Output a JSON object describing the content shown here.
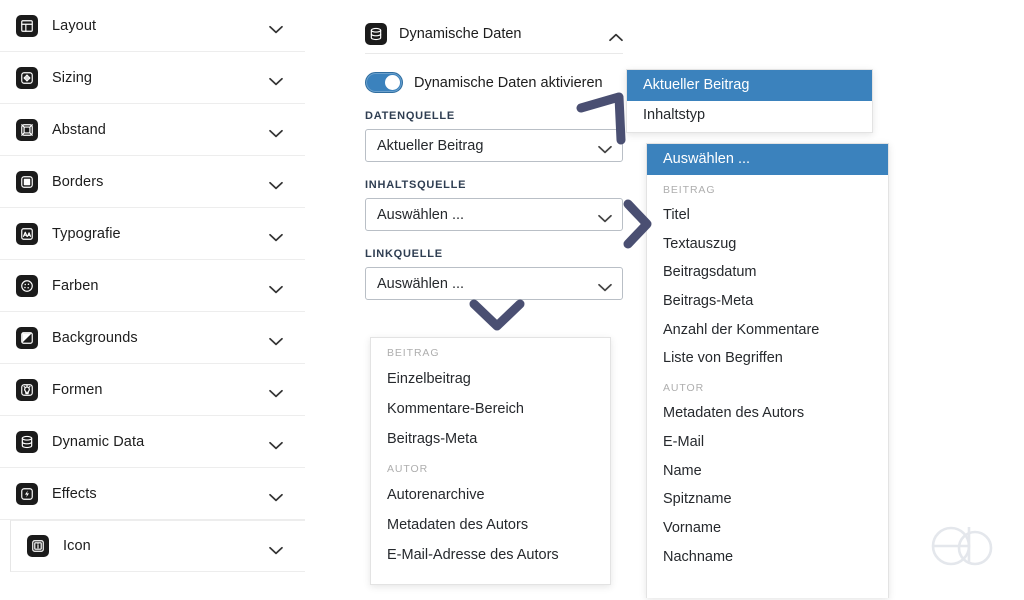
{
  "sidebar": {
    "items": [
      {
        "label": "Layout",
        "icon": "layout-icon",
        "chevron": "chevron-down-icon"
      },
      {
        "label": "Sizing",
        "icon": "sizing-icon",
        "chevron": "chevron-down-icon"
      },
      {
        "label": "Abstand",
        "icon": "spacing-icon",
        "chevron": "chevron-down-icon"
      },
      {
        "label": "Borders",
        "icon": "borders-icon",
        "chevron": "chevron-down-icon"
      },
      {
        "label": "Typografie",
        "icon": "typography-icon",
        "chevron": "chevron-down-icon"
      },
      {
        "label": "Farben",
        "icon": "colors-icon",
        "chevron": "chevron-down-icon"
      },
      {
        "label": "Backgrounds",
        "icon": "backgrounds-icon",
        "chevron": "chevron-down-icon"
      },
      {
        "label": "Formen",
        "icon": "shapes-icon",
        "chevron": "chevron-down-icon"
      },
      {
        "label": "Dynamic Data",
        "icon": "database-icon",
        "chevron": "chevron-down-icon"
      },
      {
        "label": "Effects",
        "icon": "effects-icon",
        "chevron": "chevron-down-icon"
      },
      {
        "label": "Icon",
        "icon": "info-icon",
        "chevron": "chevron-down-icon"
      }
    ]
  },
  "panel": {
    "title": "Dynamische Daten",
    "icon": "database-icon",
    "collapse_icon": "chevron-up-icon",
    "toggle": {
      "label": "Dynamische Daten aktivieren",
      "state": "on"
    },
    "fields": [
      {
        "label": "DATENQUELLE",
        "value": "Aktueller Beitrag",
        "chevron": "chevron-down-icon"
      },
      {
        "label": "INHALTSQUELLE",
        "value": "Auswählen ...",
        "chevron": "chevron-down-icon"
      },
      {
        "label": "LINKQUELLE",
        "value": "Auswählen ...",
        "chevron": "chevron-down-icon"
      }
    ]
  },
  "datasource_dropdown": {
    "options": [
      {
        "label": "Aktueller Beitrag",
        "selected": true
      },
      {
        "label": "Inhaltstyp",
        "selected": false
      }
    ]
  },
  "linksource_dropdown": {
    "groups": [
      {
        "title": "BEITRAG",
        "options": [
          "Einzelbeitrag",
          "Kommentare-Bereich",
          "Beitrags-Meta"
        ]
      },
      {
        "title": "AUTOR",
        "options": [
          "Autorenarchive",
          "Metadaten des Autors",
          "E-Mail-Adresse des Autors"
        ]
      }
    ]
  },
  "contentsource_dropdown": {
    "selected": "Auswählen ...",
    "groups": [
      {
        "title": "BEITRAG",
        "options": [
          "Titel",
          "Textauszug",
          "Beitragsdatum",
          "Beitrags-Meta",
          "Anzahl der Kommentare",
          "Liste von Begriffen"
        ]
      },
      {
        "title": "AUTOR",
        "options": [
          "Metadaten des Autors",
          "E-Mail",
          "Name",
          "Spitzname",
          "Vorname",
          "Nachname"
        ]
      }
    ]
  },
  "annotations": [
    {
      "name": "arrow-to-datasource-dropdown",
      "shape": "bent-arrow-up-right"
    },
    {
      "name": "arrow-to-contentsource-dropdown",
      "shape": "chevron-right"
    },
    {
      "name": "arrow-to-linksource-list",
      "shape": "chevron-down"
    }
  ],
  "watermark": {
    "name": "eb-logo-watermark"
  },
  "colors": {
    "accent_blue": "#3b82bd",
    "arrow_navy": "#4a4f72",
    "icon_dark": "#1b1b1b",
    "group_gray": "#aeaeae"
  }
}
